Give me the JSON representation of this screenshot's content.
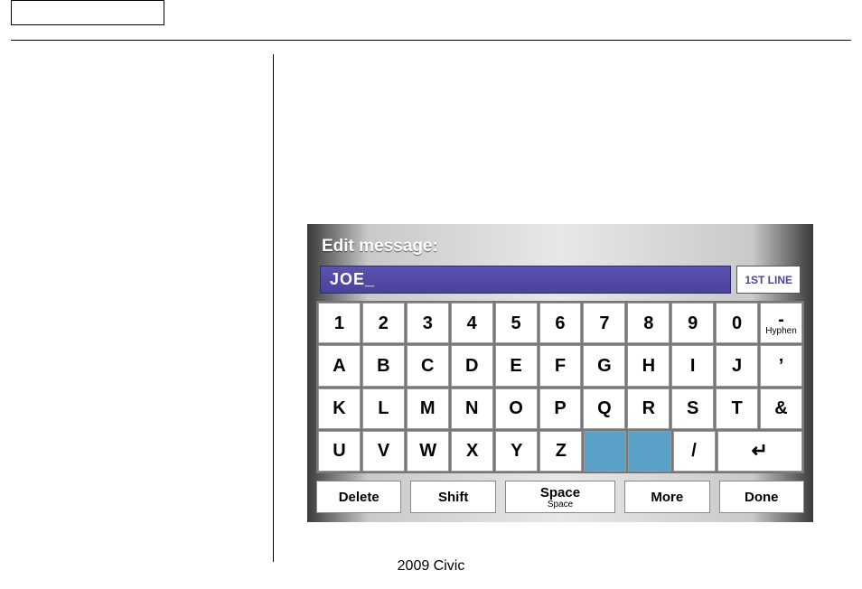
{
  "footer": "2009  Civic",
  "keyboard": {
    "title": "Edit message:",
    "input_value": "JOE_",
    "line_badge": "1ST LINE",
    "rows": [
      [
        {
          "label": "1"
        },
        {
          "label": "2"
        },
        {
          "label": "3"
        },
        {
          "label": "4"
        },
        {
          "label": "5"
        },
        {
          "label": "6"
        },
        {
          "label": "7"
        },
        {
          "label": "8"
        },
        {
          "label": "9"
        },
        {
          "label": "0"
        },
        {
          "label": "-",
          "sub": "Hyphen"
        }
      ],
      [
        {
          "label": "A"
        },
        {
          "label": "B"
        },
        {
          "label": "C"
        },
        {
          "label": "D"
        },
        {
          "label": "E"
        },
        {
          "label": "F"
        },
        {
          "label": "G"
        },
        {
          "label": "H"
        },
        {
          "label": "I"
        },
        {
          "label": "J"
        },
        {
          "label": "’"
        }
      ],
      [
        {
          "label": "K"
        },
        {
          "label": "L"
        },
        {
          "label": "M"
        },
        {
          "label": "N"
        },
        {
          "label": "O"
        },
        {
          "label": "P"
        },
        {
          "label": "Q"
        },
        {
          "label": "R"
        },
        {
          "label": "S"
        },
        {
          "label": "T"
        },
        {
          "label": "&"
        }
      ],
      [
        {
          "label": "U"
        },
        {
          "label": "V"
        },
        {
          "label": "W"
        },
        {
          "label": "X"
        },
        {
          "label": "Y"
        },
        {
          "label": "Z"
        },
        {
          "label": "",
          "blank": true
        },
        {
          "label": "",
          "blank": true
        },
        {
          "label": "/"
        },
        {
          "label": "↵",
          "enter": true
        }
      ]
    ],
    "actions": {
      "delete": "Delete",
      "shift": "Shift",
      "space": "Space",
      "space_sub": "Space",
      "more": "More",
      "done": "Done"
    }
  }
}
